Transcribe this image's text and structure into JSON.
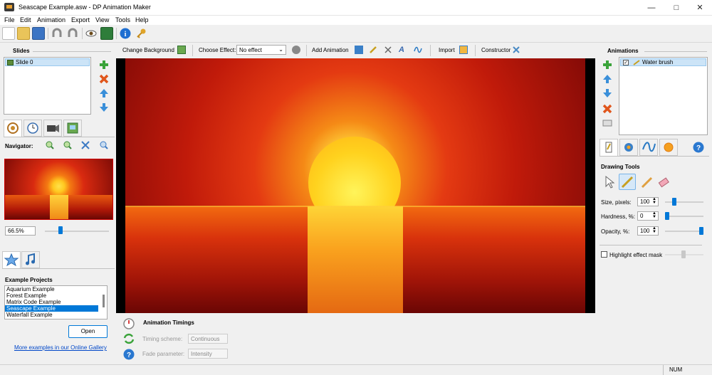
{
  "window": {
    "title": "Seascape Example.asw - DP Animation Maker"
  },
  "menu": [
    "File",
    "Edit",
    "Animation",
    "Export",
    "View",
    "Tools",
    "Help"
  ],
  "slides": {
    "header": "Slides",
    "items": [
      "Slide 0"
    ]
  },
  "navigator": {
    "label": "Navigator:",
    "zoom": "66.5%",
    "zoom_level": 0.23
  },
  "examples": {
    "header": "Example Projects",
    "items": [
      "Aquarium Example",
      "Forest Example",
      "Matrix Code Example",
      "Seascape Example",
      "Waterfall Example"
    ],
    "selected": "Seascape Example",
    "open_label": "Open",
    "gallery_link": "More examples in our Online Gallery"
  },
  "topbar": {
    "change_background": "Change Background",
    "choose_effect": "Choose Effect:",
    "effect_value": "No effect",
    "add_animation": "Add Animation",
    "import": "Import",
    "constructor": "Constructor"
  },
  "timings": {
    "header": "Animation Timings",
    "scheme_label": "Timing scheme:",
    "scheme_value": "Continuous",
    "fade_label": "Fade parameter:",
    "fade_value": "Intensity"
  },
  "animations": {
    "header": "Animations",
    "items": [
      "Water brush"
    ]
  },
  "drawing": {
    "header": "Drawing Tools",
    "size_label": "Size, pixels:",
    "size_value": "100",
    "size_level": 0.2,
    "hardness_label": "Hardness, %:",
    "hardness_value": "0",
    "hardness_level": 0.0,
    "opacity_label": "Opacity, %:",
    "opacity_value": "100",
    "opacity_level": 1.0,
    "highlight_label": "Highlight effect mask"
  },
  "status": {
    "num": "NUM"
  }
}
